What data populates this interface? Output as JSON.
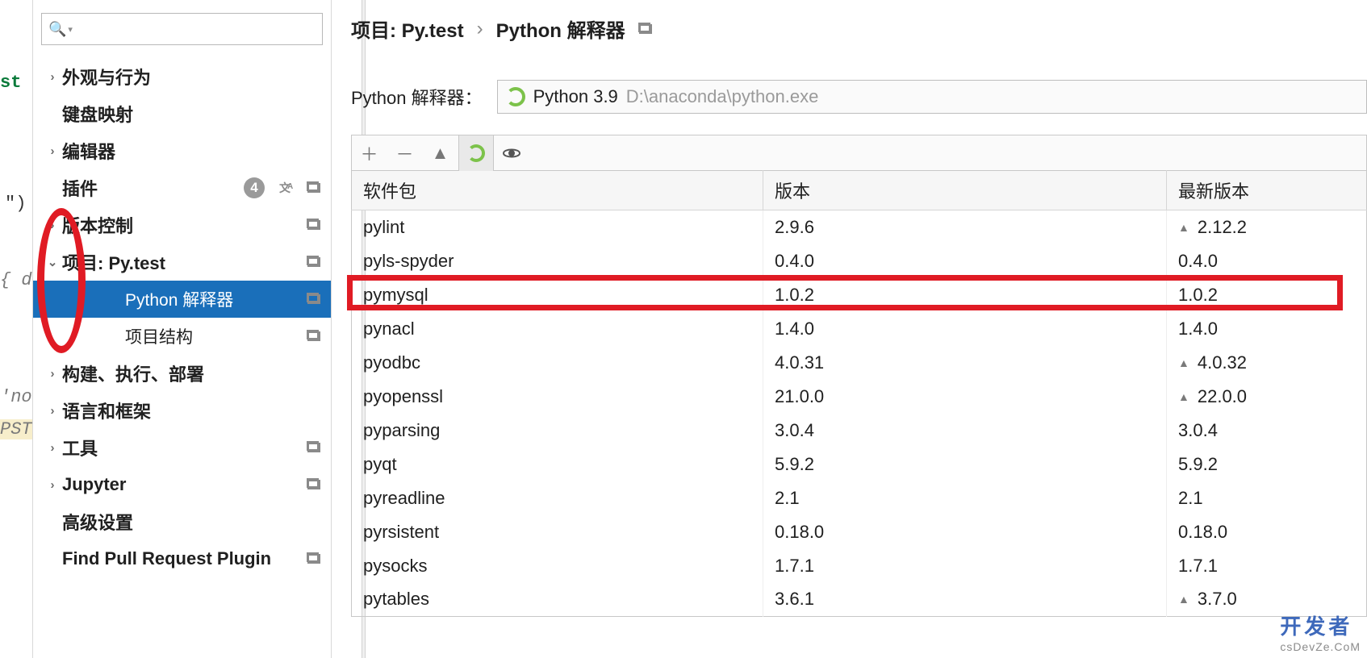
{
  "gutter": {
    "g1": "st",
    "g2": "\")",
    "g3": "{  d",
    "g4": "'no",
    "g5": "PST"
  },
  "sidebar": {
    "items": [
      {
        "label": "外观与行为",
        "chev": "›"
      },
      {
        "label": "键盘映射"
      },
      {
        "label": "编辑器",
        "chev": "›"
      },
      {
        "label": "插件",
        "badge": "4",
        "lang": true,
        "reset": true
      },
      {
        "label": "版本控制",
        "chev": "›",
        "reset": true
      },
      {
        "label": "项目: Py.test",
        "chev": "⌄",
        "reset": true,
        "children": [
          {
            "label": "Python 解释器",
            "selected": true,
            "reset": true
          },
          {
            "label": "项目结构",
            "reset": true
          }
        ]
      },
      {
        "label": "构建、执行、部署",
        "chev": "›"
      },
      {
        "label": "语言和框架",
        "chev": "›"
      },
      {
        "label": "工具",
        "chev": "›",
        "reset": true
      },
      {
        "label": "Jupyter",
        "chev": "›",
        "reset": true
      },
      {
        "label": "高级设置"
      },
      {
        "label": "Find Pull Request Plugin",
        "reset": true
      }
    ]
  },
  "breadcrumb": {
    "a": "项目: Py.test",
    "sep": "›",
    "b": "Python 解释器"
  },
  "interpreter": {
    "label": "Python 解释器：",
    "name": "Python 3.9",
    "path": "D:\\anaconda\\python.exe"
  },
  "table": {
    "headers": {
      "pkg": "软件包",
      "ver": "版本",
      "latest": "最新版本"
    },
    "rows": [
      {
        "pkg": "pylint",
        "ver": "2.9.6",
        "latest": "2.12.2",
        "upgrade": true
      },
      {
        "pkg": "pyls-spyder",
        "ver": "0.4.0",
        "latest": "0.4.0"
      },
      {
        "pkg": "pymysql",
        "ver": "1.0.2",
        "latest": "1.0.2",
        "highlight": true
      },
      {
        "pkg": "pynacl",
        "ver": "1.4.0",
        "latest": "1.4.0"
      },
      {
        "pkg": "pyodbc",
        "ver": "4.0.31",
        "latest": "4.0.32",
        "upgrade": true
      },
      {
        "pkg": "pyopenssl",
        "ver": "21.0.0",
        "latest": "22.0.0",
        "upgrade": true
      },
      {
        "pkg": "pyparsing",
        "ver": "3.0.4",
        "latest": "3.0.4"
      },
      {
        "pkg": "pyqt",
        "ver": "5.9.2",
        "latest": "5.9.2"
      },
      {
        "pkg": "pyreadline",
        "ver": "2.1",
        "latest": "2.1"
      },
      {
        "pkg": "pyrsistent",
        "ver": "0.18.0",
        "latest": "0.18.0"
      },
      {
        "pkg": "pysocks",
        "ver": "1.7.1",
        "latest": "1.7.1"
      },
      {
        "pkg": "pytables",
        "ver": "3.6.1",
        "latest": "3.7.0",
        "upgrade": true
      }
    ]
  },
  "watermark": {
    "main": "开发者",
    "sub": "csDevZe.CoM"
  }
}
